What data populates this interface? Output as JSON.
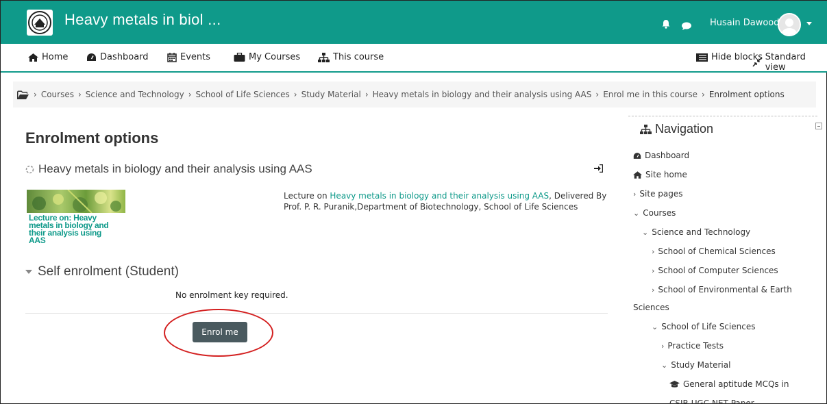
{
  "header": {
    "site_title": "Heavy metals in biol ...",
    "user_name": "Husain Dawoodi",
    "colors": {
      "brand": "#0f9a8a",
      "button": "#4a5a5f",
      "highlight": "#d31f1f"
    }
  },
  "nav": {
    "home": "Home",
    "dashboard": "Dashboard",
    "events": "Events",
    "my_courses": "My Courses",
    "this_course": "This course",
    "hide_blocks": "Hide blocks",
    "standard_view": "Standard view"
  },
  "breadcrumb": [
    "Courses",
    "Science and Technology",
    "School of Life Sciences",
    "Study Material",
    "Heavy metals in biology and their analysis using AAS",
    "Enrol me in this course",
    "Enrolment options"
  ],
  "main": {
    "title": "Enrolment options",
    "course_name": "Heavy metals in biology and their analysis using AAS",
    "image_caption": "Lecture on: Heavy metals in biology and their analysis using AAS",
    "desc_prefix": "Lecture on ",
    "desc_link": "Heavy metals in biology and their analysis using AAS",
    "desc_suffix": ", Delivered By Prof. P. R. Puranik,Department of Biotechnology, School of Life Sciences",
    "section_title": "Self enrolment (Student)",
    "no_key": "No enrolment key required.",
    "enrol_button": "Enrol me"
  },
  "sidebar": {
    "title": "Navigation",
    "items": [
      "Dashboard",
      "Site home",
      "Site pages",
      "Courses",
      "Science and Technology",
      "School of Chemical Sciences",
      "School of Computer Sciences",
      "School of Environmental & Earth",
      "Sciences",
      "School of Life Sciences",
      "Practice Tests",
      "Study Material",
      "General aptitude MCQs in",
      "CSIR-UGC NET Paper"
    ]
  }
}
